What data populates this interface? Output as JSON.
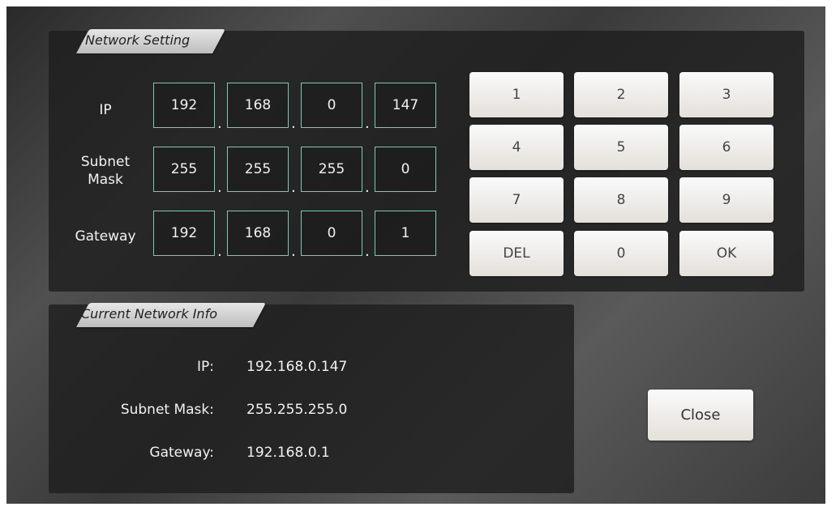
{
  "network_setting": {
    "title": "Network Setting",
    "ip": {
      "label": "IP",
      "octets": [
        "192",
        "168",
        "0",
        "147"
      ]
    },
    "subnet": {
      "label_line1": "Subnet",
      "label_line2": "Mask",
      "octets": [
        "255",
        "255",
        "255",
        "0"
      ]
    },
    "gateway": {
      "label": "Gateway",
      "octets": [
        "192",
        "168",
        "0",
        "1"
      ]
    },
    "separator": "."
  },
  "keypad": {
    "keys": [
      "1",
      "2",
      "3",
      "4",
      "5",
      "6",
      "7",
      "8",
      "9",
      "DEL",
      "0",
      "OK"
    ]
  },
  "current_info": {
    "title": "Current Network Info",
    "ip_label": "IP:",
    "ip_value": "192.168.0.147",
    "subnet_label": "Subnet Mask:",
    "subnet_value": "255.255.255.0",
    "gateway_label": "Gateway:",
    "gateway_value": "192.168.0.1"
  },
  "close_label": "Close",
  "colors": {
    "field_border": "#7fc8b8",
    "key_bg": "#f2efea",
    "panel_bg": "#1e1e1e"
  }
}
